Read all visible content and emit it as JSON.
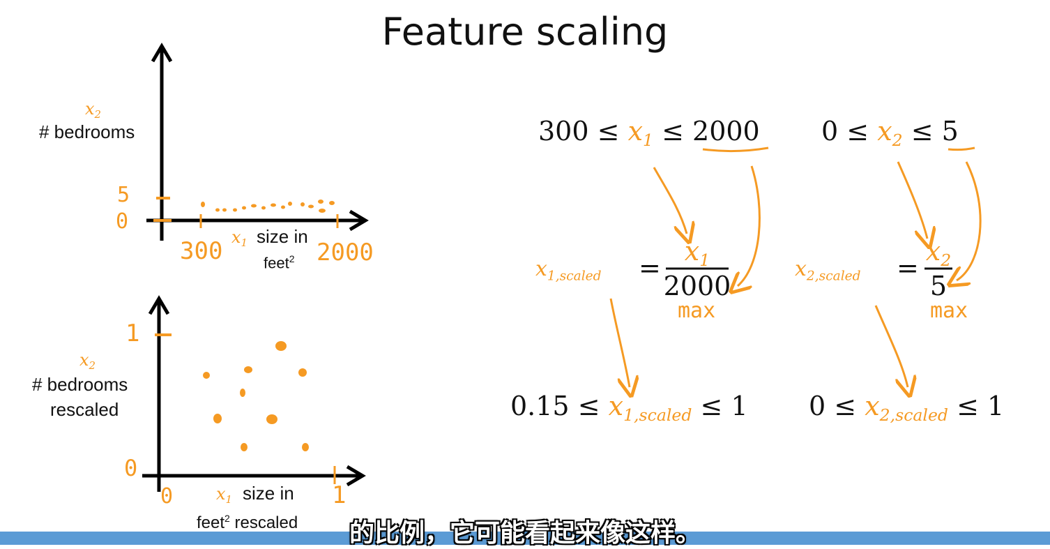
{
  "title": "Feature scaling",
  "top_plot": {
    "y_var": "x",
    "y_var_sub": "2",
    "y_label": "# bedrooms",
    "y_tick_high": "5",
    "y_tick_low": "0",
    "x_var": "x",
    "x_var_sub": "1",
    "x_label_line1": "size in",
    "x_label_line2": "feet",
    "x_label_sup": "2",
    "x_tick_low": "300",
    "x_tick_high": "2000"
  },
  "bottom_plot": {
    "y_var": "x",
    "y_var_sub": "2",
    "y_label_line1": "# bedrooms",
    "y_label_line2": "rescaled",
    "y_tick_high": "1",
    "y_tick_low": "0",
    "x_var": "x",
    "x_var_sub": "1",
    "x_label_line1": "size in",
    "x_label_line2": "feet",
    "x_label_sup": "2",
    "x_label_suffix": " rescaled",
    "x_tick_low": "0",
    "x_tick_high": "1"
  },
  "range_x1": {
    "low": "300",
    "op": "≤",
    "var": "x",
    "sub": "1",
    "high": "2000"
  },
  "range_x2": {
    "low": "0",
    "op": "≤",
    "var": "x",
    "sub": "2",
    "high": "5"
  },
  "scaled_x1": {
    "var": "x",
    "sub": "1,scaled",
    "eq": "=",
    "num_var": "x",
    "num_sub": "1",
    "den": "2000",
    "note": "max"
  },
  "scaled_x2": {
    "var": "x",
    "sub": "2,scaled",
    "eq": "=",
    "num_var": "x",
    "num_sub": "2",
    "den": "5",
    "note": "max"
  },
  "result_x1": {
    "low": "0.15",
    "op": "≤",
    "var": "x",
    "sub": "1,scaled",
    "high": "1"
  },
  "result_x2": {
    "low": "0",
    "op": "≤",
    "var": "x",
    "sub": "2,scaled",
    "high": "1"
  },
  "caption": "的比例，它可能看起来像这样。",
  "colors": {
    "accent": "#f59a23",
    "ink": "#111111",
    "bar": "#5b9bd5"
  }
}
